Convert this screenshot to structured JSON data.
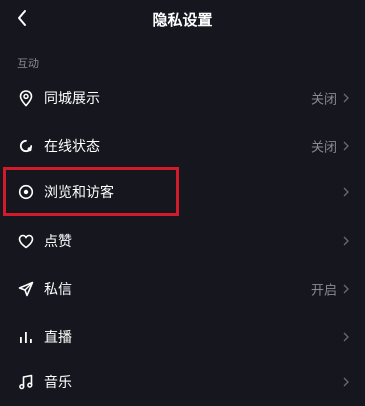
{
  "header": {
    "title": "隐私设置"
  },
  "section": {
    "label": "互动"
  },
  "rows": [
    {
      "label": "同城展示",
      "value": "关闭",
      "icon": "location-pin-icon"
    },
    {
      "label": "在线状态",
      "value": "关闭",
      "icon": "online-status-icon"
    },
    {
      "label": "浏览和访客",
      "value": "",
      "icon": "eye-icon"
    },
    {
      "label": "点赞",
      "value": "",
      "icon": "heart-icon"
    },
    {
      "label": "私信",
      "value": "开启",
      "icon": "send-icon"
    },
    {
      "label": "直播",
      "value": "",
      "icon": "bars-icon"
    },
    {
      "label": "音乐",
      "value": "",
      "icon": "music-note-icon"
    }
  ],
  "colors": {
    "background": "#16161f",
    "text": "#ffffff",
    "secondary": "#8a8a93",
    "highlight": "#d11a2a"
  }
}
